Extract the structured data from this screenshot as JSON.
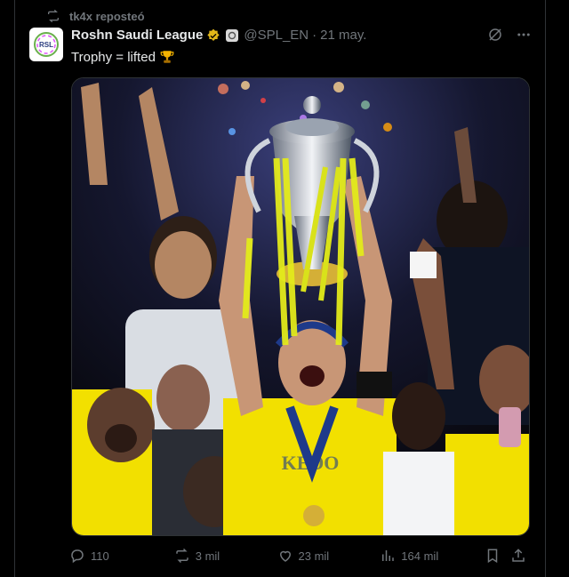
{
  "repost": {
    "label": "tk4x reposteó",
    "icon": "repost-icon"
  },
  "author": {
    "name": "Roshn Saudi League",
    "handle": "@SPL_EN",
    "separator": "·",
    "date": "21 may.",
    "avatar_text": "RSL"
  },
  "tweet": {
    "text": "Trophy = lifted"
  },
  "actions": {
    "replies": "110",
    "reposts": "3 mil",
    "likes": "23 mil",
    "views": "164 mil"
  },
  "colors": {
    "background": "#000000",
    "text": "#e7e9ea",
    "muted": "#71767b",
    "verified": "#e2b719",
    "jersey_yellow": "#f2e000"
  }
}
